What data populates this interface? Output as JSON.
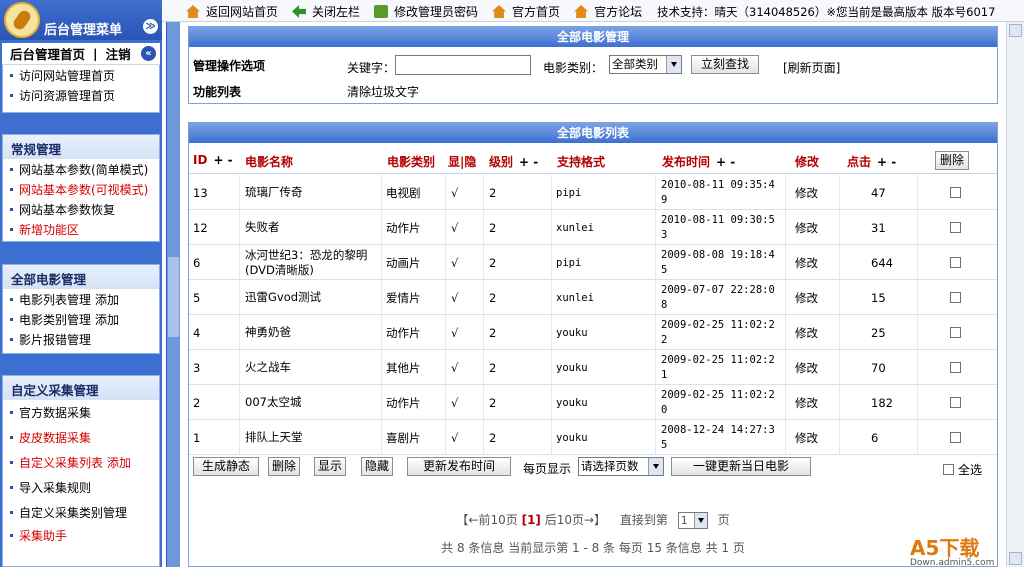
{
  "app": {
    "menu_title": "后台管理菜单",
    "menu_toggle": "≫",
    "sub_home": "后台管理首页",
    "sub_sep": "|",
    "sub_logout": "注销",
    "sub_collapse": "«"
  },
  "topnav": {
    "items": [
      "返回网站首页",
      "关闭左栏",
      "修改管理员密码",
      "官方首页",
      "官方论坛"
    ],
    "tech": "技术支持：晴天（314048526）※您当前是最高版本 版本号6017"
  },
  "sidebar": {
    "panel1": {
      "items": [
        "访问网站管理首页",
        "访问资源管理首页"
      ]
    },
    "panel2": {
      "title": "常规管理",
      "items": [
        "网站基本参数(简单模式)",
        "网站基本参数(可视模式)",
        "网站基本参数恢复",
        "新增功能区"
      ]
    },
    "panel3": {
      "title": "全部电影管理",
      "items": [
        "电影列表管理",
        "电影类别管理",
        "影片报错管理"
      ],
      "add": "添加"
    },
    "panel4": {
      "title": "自定义采集管理",
      "items": [
        "官方数据采集",
        "皮皮数据采集",
        "自定义采集列表",
        "导入采集规则",
        "自定义采集类别管理",
        "采集助手"
      ],
      "add": "添加"
    }
  },
  "manage": {
    "title": "全部电影管理",
    "options_label": "管理操作选项",
    "keyword_label": "关键字：",
    "keyword_value": "",
    "category_label": "电影类别：",
    "category_selected": "全部类别",
    "search_button": "立刻查找",
    "refresh_link": "[刷新页面]",
    "func_label": "功能列表",
    "func_clear": "清除垃圾文字"
  },
  "list": {
    "title": "全部电影列表",
    "headers": {
      "id": "ID",
      "name": "电影名称",
      "category": "电影类别",
      "show_hide": "显|隐",
      "level": "级别",
      "format": "支持格式",
      "time": "发布时间",
      "edit": "修改",
      "hits": "点击",
      "delete": "删除",
      "sort": "+ -"
    },
    "rows": [
      {
        "id": "13",
        "name": "琉璃厂传奇",
        "category": "电视剧",
        "vis": "√",
        "level": "2",
        "format": "pipi",
        "time": "2010-08-11 09:35:49",
        "edit": "修改",
        "hits": "47"
      },
      {
        "id": "12",
        "name": "失败者",
        "category": "动作片",
        "vis": "√",
        "level": "2",
        "format": "xunlei",
        "time": "2010-08-11 09:30:53",
        "edit": "修改",
        "hits": "31"
      },
      {
        "id": "6",
        "name": "冰河世纪3：恐龙的黎明(DVD清晰版)",
        "category": "动画片",
        "vis": "√",
        "level": "2",
        "format": "pipi",
        "time": "2009-08-08 19:18:45",
        "edit": "修改",
        "hits": "644"
      },
      {
        "id": "5",
        "name": "迅雷Gvod测试",
        "category": "爱情片",
        "vis": "√",
        "level": "2",
        "format": "xunlei",
        "time": "2009-07-07 22:28:08",
        "edit": "修改",
        "hits": "15"
      },
      {
        "id": "4",
        "name": "神勇奶爸",
        "category": "动作片",
        "vis": "√",
        "level": "2",
        "format": "youku",
        "time": "2009-02-25 11:02:22",
        "edit": "修改",
        "hits": "25"
      },
      {
        "id": "3",
        "name": "火之战车",
        "category": "其他片",
        "vis": "√",
        "level": "2",
        "format": "youku",
        "time": "2009-02-25 11:02:21",
        "edit": "修改",
        "hits": "70"
      },
      {
        "id": "2",
        "name": "007太空城",
        "category": "动作片",
        "vis": "√",
        "level": "2",
        "format": "youku",
        "time": "2009-02-25 11:02:20",
        "edit": "修改",
        "hits": "182"
      },
      {
        "id": "1",
        "name": "排队上天堂",
        "category": "喜剧片",
        "vis": "√",
        "level": "2",
        "format": "youku",
        "time": "2008-12-24 14:27:35",
        "edit": "修改",
        "hits": "6"
      }
    ],
    "actions": {
      "static": "生成静态",
      "delete": "删除",
      "show": "显示",
      "hide": "隐藏",
      "update_time": "更新发布时间",
      "per_page_label": "每页显示",
      "per_page_select": "请选择页数",
      "update_today": "一键更新当日电影",
      "select_all": "全选"
    },
    "pager": {
      "prev": "【←前10页",
      "current": "[1]",
      "next": "后10页→】",
      "jump_label": "直接到第",
      "page_select": "1",
      "page_unit": "页",
      "summary": "共 8 条信息 当前显示第 1 - 8 条 每页 15 条信息 共 1 页"
    }
  },
  "watermark": {
    "brand": "A5",
    "brand2": "下载",
    "domain": "Down.admin5.com"
  },
  "colors": {
    "accent": "#3d6fd1",
    "header_text": "#b30000",
    "red_link": "#d40000"
  }
}
